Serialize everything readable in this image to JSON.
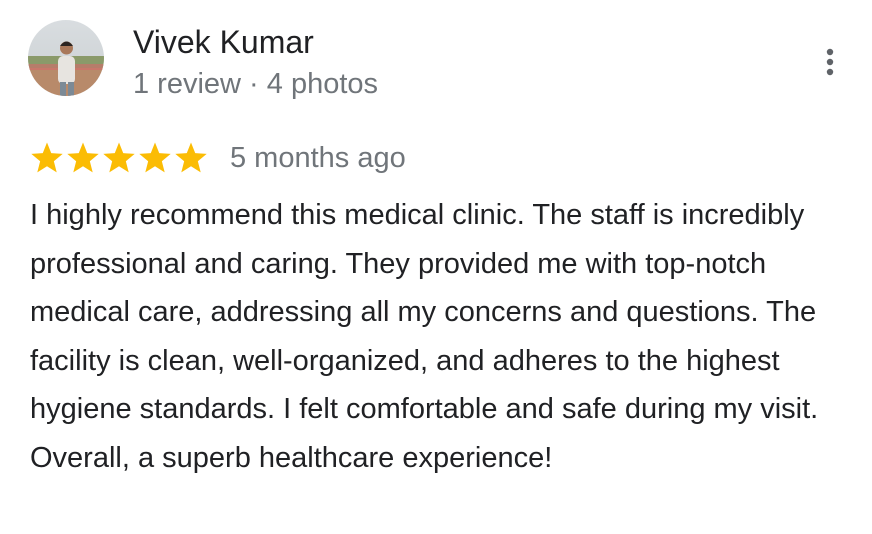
{
  "review": {
    "reviewer": {
      "name": "Vivek Kumar",
      "meta": "1 review · 4 photos",
      "avatar": "profile-photo"
    },
    "rating": {
      "value": 5,
      "max": 5,
      "star_color": "#fbbc04"
    },
    "date": "5 months ago",
    "text": "I highly recommend this medical clinic. The staff is incredibly professional and caring. They provided me with top-notch medical care, addressing all my concerns and questions. The facility is clean, well-organized, and adheres to the highest hygiene standards. I felt comfortable and safe during my visit. Overall, a superb healthcare experience!",
    "more_options_icon": "more-vert-icon"
  }
}
